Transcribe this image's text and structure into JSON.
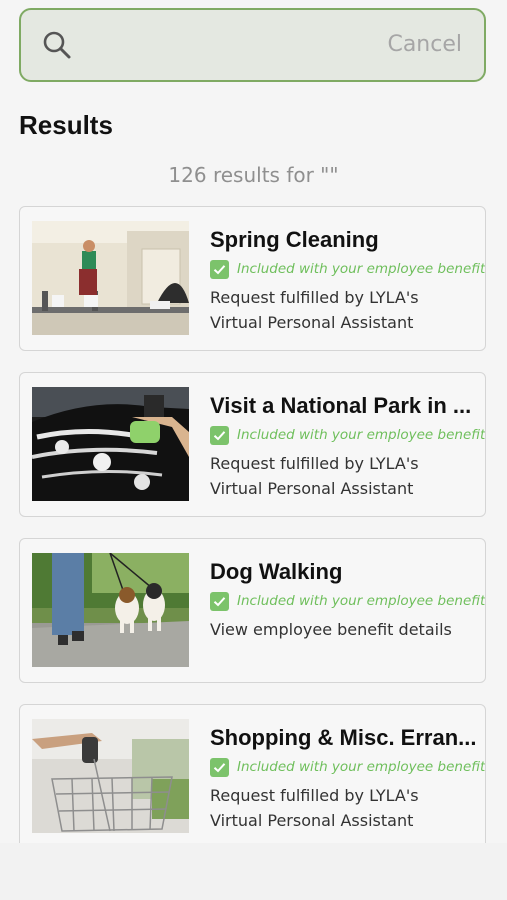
{
  "search": {
    "value": "",
    "placeholder": "",
    "cancel_label": "Cancel"
  },
  "results": {
    "heading": "Results",
    "count_text": "126 results for \"\""
  },
  "cards": [
    {
      "title": "Spring Cleaning",
      "benefit": "Included with your employee benefits",
      "desc_line1": "Request fulfilled by LYLA's",
      "desc_line2": "Virtual Personal Assistant",
      "image": "house-painting-photo"
    },
    {
      "title": "Visit a National Park in ...",
      "benefit": "Included with your employee benefits",
      "desc_line1": "Request fulfilled by LYLA's",
      "desc_line2": "Virtual Personal Assistant",
      "image": "car-washing-photo"
    },
    {
      "title": "Dog Walking",
      "benefit": "Included with your employee benefits",
      "desc_line1": "View employee benefit details",
      "desc_line2": "",
      "image": "dog-walking-photo"
    },
    {
      "title": "Shopping & Misc. Erran...",
      "benefit": "Included with your employee benefits",
      "desc_line1": "Request fulfilled by LYLA's",
      "desc_line2": "Virtual Personal Assistant",
      "image": "shopping-cart-photo"
    }
  ],
  "colors": {
    "accent_green": "#7faa63",
    "benefit_green": "#6fbf5c",
    "background": "#f5f5f5"
  }
}
